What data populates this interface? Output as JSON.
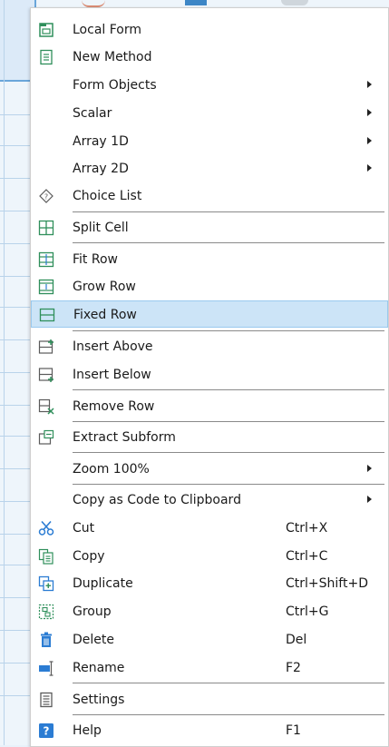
{
  "menu": {
    "items": [
      {
        "label": "Local Form",
        "icon": "local-form-icon"
      },
      {
        "label": "New Method",
        "icon": "new-method-icon"
      },
      {
        "label": "Form Objects",
        "submenu": true
      },
      {
        "label": "Scalar",
        "submenu": true
      },
      {
        "label": "Array 1D",
        "submenu": true
      },
      {
        "label": "Array 2D",
        "submenu": true
      },
      {
        "label": "Choice List",
        "icon": "choice-list-icon"
      },
      {
        "label": "Split Cell",
        "icon": "split-cell-icon"
      },
      {
        "label": "Fit Row",
        "icon": "fit-row-icon"
      },
      {
        "label": "Grow Row",
        "icon": "grow-row-icon"
      },
      {
        "label": "Fixed Row",
        "icon": "fixed-row-icon",
        "highlighted": true
      },
      {
        "label": "Insert Above",
        "icon": "insert-above-icon"
      },
      {
        "label": "Insert Below",
        "icon": "insert-below-icon"
      },
      {
        "label": "Remove Row",
        "icon": "remove-row-icon"
      },
      {
        "label": "Extract Subform",
        "icon": "extract-subform-icon"
      },
      {
        "label": "Zoom 100%",
        "submenu": true
      },
      {
        "label": "Copy as Code to Clipboard",
        "submenu": true
      },
      {
        "label": "Cut",
        "icon": "scissors-icon",
        "shortcut": "Ctrl+X"
      },
      {
        "label": "Copy",
        "icon": "copy-icon",
        "shortcut": "Ctrl+C"
      },
      {
        "label": "Duplicate",
        "icon": "duplicate-icon",
        "shortcut": "Ctrl+Shift+D"
      },
      {
        "label": "Group",
        "icon": "group-icon",
        "shortcut": "Ctrl+G"
      },
      {
        "label": "Delete",
        "icon": "trash-icon",
        "shortcut": "Del"
      },
      {
        "label": "Rename",
        "icon": "rename-icon",
        "shortcut": "F2"
      },
      {
        "label": "Settings",
        "icon": "settings-icon"
      },
      {
        "label": "Help",
        "icon": "help-icon",
        "shortcut": "F1"
      }
    ]
  },
  "colors": {
    "highlight": "#cce4f7",
    "icon_green": "#2f8f5b",
    "icon_blue": "#2b7cd3",
    "icon_gray": "#5a5a5a"
  }
}
